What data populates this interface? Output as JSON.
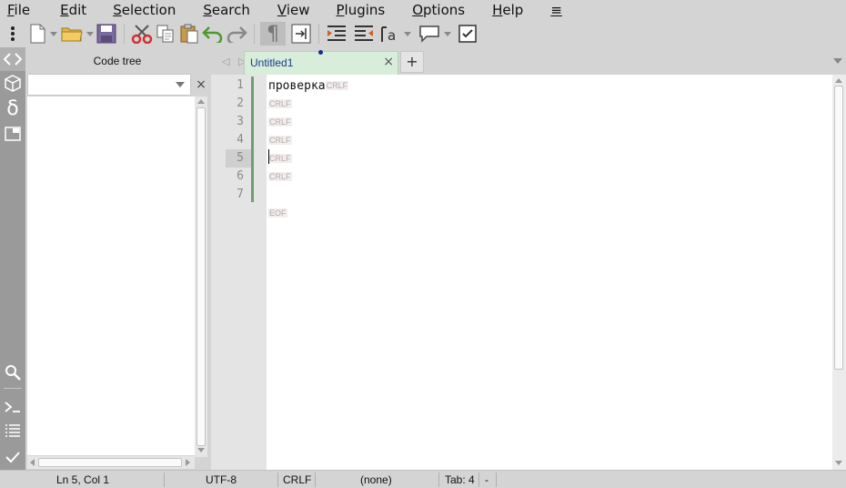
{
  "menu": [
    "File",
    "Edit",
    "Selection",
    "Search",
    "View",
    "Plugins",
    "Options",
    "Help",
    "≡"
  ],
  "toolbar": {
    "buttons": [
      "menu-dots-icon",
      "new-file-icon",
      "open-folder-icon",
      "save-icon",
      "cut-icon",
      "copy-icon",
      "paste-icon",
      "undo-icon",
      "redo-icon",
      "pilcrow-icon",
      "wrap-icon",
      "indent-icon",
      "unindent-icon",
      "case-icon",
      "comment-icon",
      "checkbox-icon"
    ],
    "pilcrow_glyph": "¶"
  },
  "side_icons": [
    "code-icon",
    "package-icon",
    "delta-icon",
    "window-icon",
    "search-icon",
    "terminal-icon",
    "list-icon",
    "check-icon"
  ],
  "delta_glyph": "δ",
  "panel": {
    "title": "Code tree",
    "combo_value": "",
    "close_glyph": "×"
  },
  "tabs": {
    "nav_glyph": "◁ ▷",
    "items": [
      {
        "label": "Untitled1",
        "close": "×"
      }
    ],
    "add_glyph": "+"
  },
  "editor": {
    "line_numbers": [
      "1",
      "2",
      "3",
      "4",
      "5",
      "6",
      "7"
    ],
    "current_line": 5,
    "lines": [
      {
        "text": "проверка",
        "eol": "CRLF"
      },
      {
        "text": "",
        "eol": "CRLF"
      },
      {
        "text": "",
        "eol": "CRLF"
      },
      {
        "text": "",
        "eol": "CRLF"
      },
      {
        "text": "",
        "eol": "CRLF"
      },
      {
        "text": "",
        "eol": "CRLF"
      },
      {
        "text": "",
        "eol": ""
      }
    ],
    "eof_marker": "EOF"
  },
  "status": {
    "position": "Ln 5, Col 1",
    "encoding": "UTF-8",
    "line_ending": "CRLF",
    "lexer": "(none)",
    "tab": "Tab: 4",
    "extra": "-"
  },
  "colors": {
    "tab_active_bg": "#d8eedb",
    "change_bar": "#6f9f6f",
    "sidebar_bg": "#9a9a9a"
  }
}
